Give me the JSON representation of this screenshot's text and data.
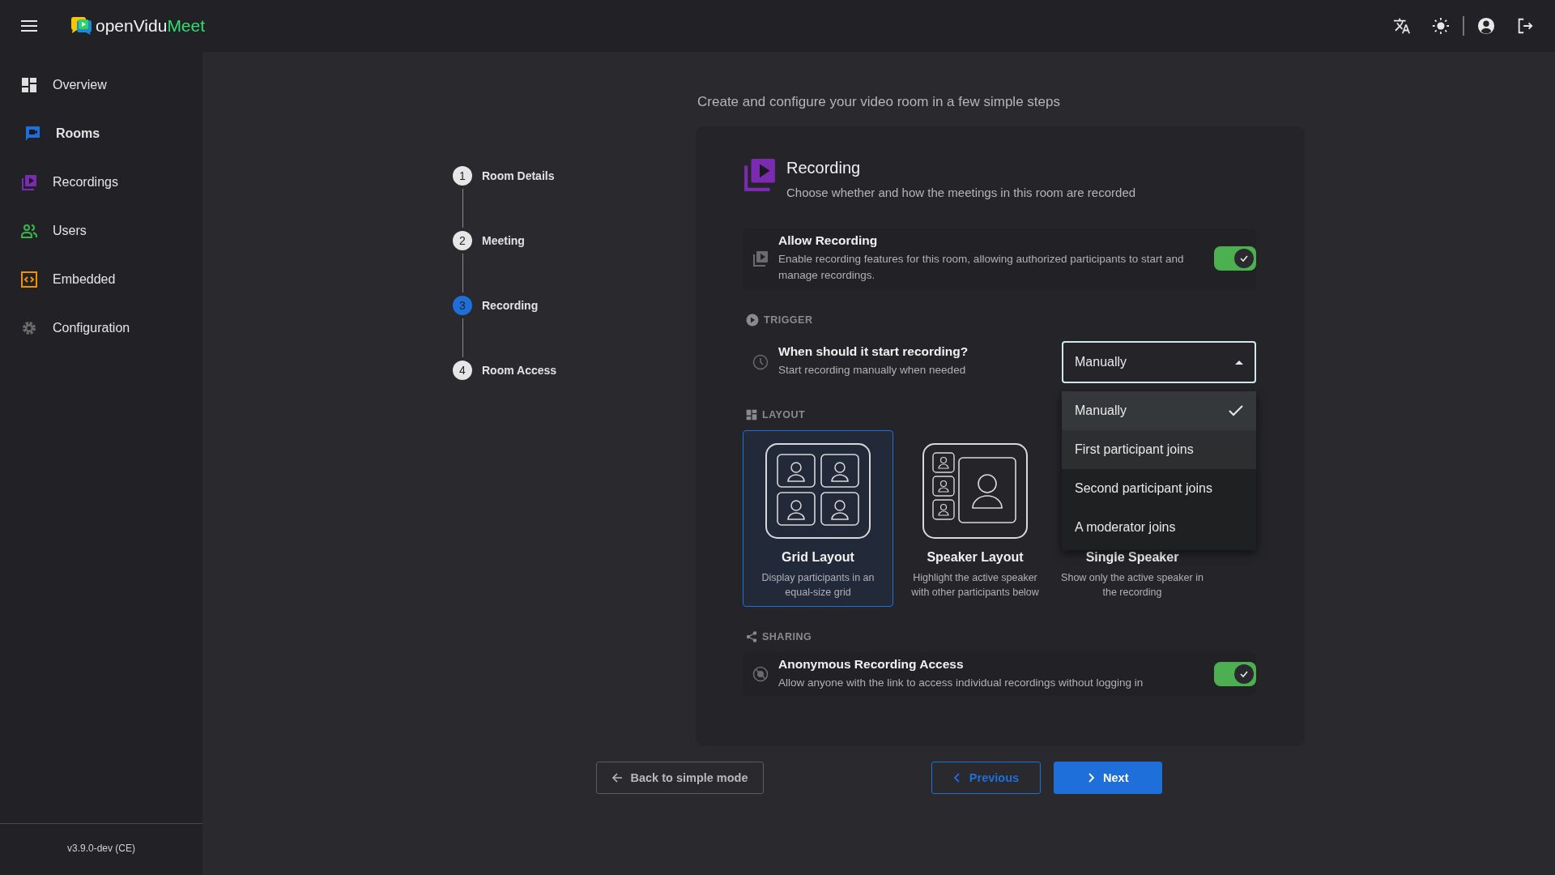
{
  "header": {
    "logo": {
      "brand": "openVidu",
      "product": "Meet"
    }
  },
  "sidebar": {
    "items": [
      {
        "kind": "overview",
        "label": "Overview",
        "selected": false
      },
      {
        "kind": "rooms",
        "label": "Rooms",
        "selected": true
      },
      {
        "kind": "recordings",
        "label": "Recordings",
        "selected": false
      },
      {
        "kind": "users",
        "label": "Users",
        "selected": false
      },
      {
        "kind": "embedded",
        "label": "Embedded",
        "selected": false
      },
      {
        "kind": "configuration",
        "label": "Configuration",
        "selected": false
      }
    ],
    "version": "v3.9.0-dev (CE)"
  },
  "subtitle": "Create and configure your video room in a few simple steps",
  "stepper": {
    "steps": [
      {
        "number": "1",
        "label": "Room Details",
        "selected": false
      },
      {
        "number": "2",
        "label": "Meeting",
        "selected": false
      },
      {
        "number": "3",
        "label": "Recording",
        "selected": true
      },
      {
        "number": "4",
        "label": "Room Access",
        "selected": false
      }
    ]
  },
  "card": {
    "title": "Recording",
    "description": "Choose whether and how the meetings in this room are recorded",
    "allow_recording": {
      "title": "Allow Recording",
      "description": "Enable recording features for this room, allowing authorized participants to start and manage recordings.",
      "on": true
    },
    "trigger": {
      "heading": "TRIGGER",
      "question": "When should it start recording?",
      "hint": "Start recording manually when needed",
      "select": {
        "value": "Manually",
        "expanded": true
      },
      "options": [
        {
          "label": "Manually",
          "selected": true,
          "hovered": false
        },
        {
          "label": "First participant joins",
          "selected": false,
          "hovered": true
        },
        {
          "label": "Second participant joins",
          "selected": false,
          "hovered": false
        },
        {
          "label": "A moderator joins",
          "selected": false,
          "hovered": false
        }
      ]
    },
    "layout": {
      "heading": "LAYOUT",
      "options": [
        {
          "kind": "grid",
          "title": "Grid Layout",
          "description": "Display participants in an equal-size grid",
          "selected": true
        },
        {
          "kind": "speaker",
          "title": "Speaker Layout",
          "description": "Highlight the active speaker with other participants below",
          "selected": false
        },
        {
          "kind": "single",
          "title": "Single Speaker",
          "description": "Show only the active speaker in the recording",
          "selected": false
        }
      ]
    },
    "sharing": {
      "heading": "SHARING",
      "title": "Anonymous Recording Access",
      "description": "Allow anyone with the link to access individual recordings without logging in",
      "on": true
    }
  },
  "buttons": {
    "back": "Back to simple mode",
    "previous": "Previous",
    "next": "Next"
  }
}
